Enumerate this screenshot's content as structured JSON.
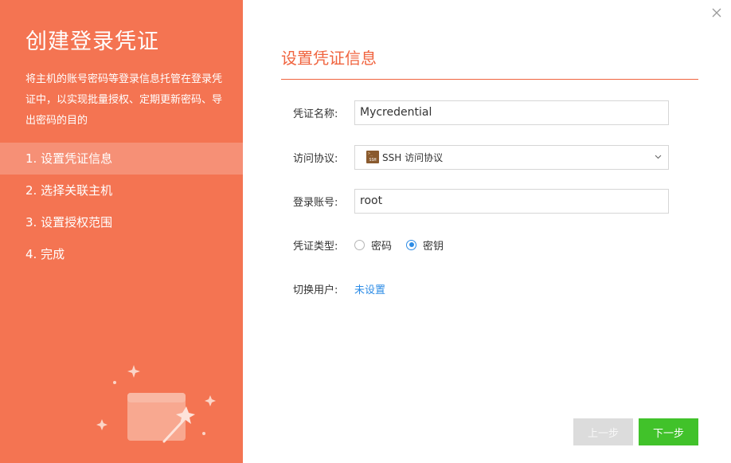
{
  "sidebar": {
    "title": "创建登录凭证",
    "description": "将主机的账号密码等登录信息托管在登录凭证中，以实现批量授权、定期更新密码、导出密码的目的",
    "steps": [
      {
        "label": "1. 设置凭证信息",
        "active": true
      },
      {
        "label": "2. 选择关联主机",
        "active": false
      },
      {
        "label": "3. 设置授权范围",
        "active": false
      },
      {
        "label": "4. 完成",
        "active": false
      }
    ]
  },
  "main": {
    "section_title": "设置凭证信息",
    "fields": {
      "name": {
        "label": "凭证名称:",
        "value": "Mycredential"
      },
      "protocol": {
        "label": "访问协议:",
        "value": "SSH 访问协议",
        "icon": "ssh-icon"
      },
      "account": {
        "label": "登录账号:",
        "value": "root"
      },
      "type": {
        "label": "凭证类型:",
        "options": [
          "密码",
          "密钥"
        ],
        "selected": "密钥"
      },
      "switch_user": {
        "label": "切换用户:",
        "value": "未设置"
      }
    }
  },
  "footer": {
    "prev_label": "上一步",
    "next_label": "下一步"
  },
  "colors": {
    "accent": "#f47452",
    "accent_active_row": "#f69076",
    "title_orange": "#f0643f",
    "link_blue": "#2d8ce6",
    "next_green": "#41c22a",
    "disabled_gray": "#dcdcdc"
  }
}
